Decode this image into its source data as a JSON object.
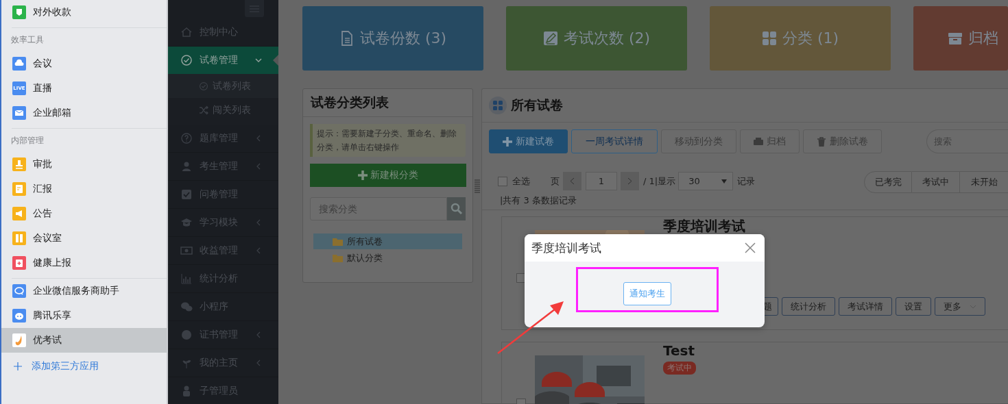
{
  "sidebar": {
    "groups": [
      {
        "items": [
          {
            "label": "对外收款",
            "color": "#2bb34a",
            "selected": false
          }
        ]
      },
      {
        "heading": "效率工具",
        "items": [
          {
            "label": "会议",
            "color": "#4a8cf0",
            "selected": false
          },
          {
            "label": "直播",
            "color": "#4a8cf0",
            "badge": "LIVE",
            "selected": false
          },
          {
            "label": "企业邮箱",
            "color": "#4a8cf0",
            "selected": false
          }
        ]
      },
      {
        "heading": "内部管理",
        "items": [
          {
            "label": "审批",
            "color": "#f7b21b",
            "selected": false
          },
          {
            "label": "汇报",
            "color": "#f7b21b",
            "selected": false
          },
          {
            "label": "公告",
            "color": "#f7b21b",
            "selected": false
          },
          {
            "label": "会议室",
            "color": "#f7b21b",
            "selected": false
          },
          {
            "label": "健康上报",
            "color": "#f0505f",
            "selected": false
          }
        ]
      },
      {
        "items": [
          {
            "label": "企业微信服务商助手",
            "color": "#4a8cf0",
            "selected": false
          },
          {
            "label": "腾讯乐享",
            "color": "#4a8cf0",
            "selected": false
          },
          {
            "label": "优考试",
            "color": "#ffffff",
            "selected": true
          }
        ]
      }
    ],
    "add_link": "添加第三方应用"
  },
  "nav": {
    "items": [
      {
        "label": "控制中心",
        "selected": false
      },
      {
        "label": "试卷管理",
        "expanded": true,
        "selected": true,
        "children": [
          {
            "label": "试卷列表",
            "selected": true
          },
          {
            "label": "闯关列表",
            "selected": false
          }
        ]
      },
      {
        "label": "题库管理",
        "expanded": false,
        "selected": false
      },
      {
        "label": "考生管理",
        "expanded": false,
        "selected": false
      },
      {
        "label": "问卷管理",
        "selected": false
      },
      {
        "label": "学习模块",
        "expanded": false,
        "selected": false
      },
      {
        "label": "收益管理",
        "expanded": false,
        "selected": false
      },
      {
        "label": "统计分析",
        "selected": false
      },
      {
        "label": "小程序",
        "selected": false
      },
      {
        "label": "证书管理",
        "expanded": false,
        "selected": false
      },
      {
        "label": "我的主页",
        "expanded": false,
        "selected": false
      },
      {
        "label": "子管理员",
        "selected": false
      }
    ]
  },
  "stats": [
    {
      "label": "试卷份数 (3)",
      "color": "#264a62"
    },
    {
      "label": "考试次数 (2)",
      "color": "#3d5633"
    },
    {
      "label": "分类 (1)",
      "color": "#63573a"
    },
    {
      "label": "归档",
      "color": "#623b31"
    }
  ],
  "category_panel": {
    "title": "试卷分类列表",
    "hint": "提示：需要新建子分类、重命名、删除分类，请单击右键操作",
    "new_button": "新建根分类",
    "search": {
      "placeholder": "搜索分类"
    },
    "tree": [
      {
        "label": "所有试卷",
        "selected": true
      },
      {
        "label": "默认分类",
        "selected": false
      }
    ]
  },
  "main_panel": {
    "title": "所有试卷",
    "toolbar": [
      {
        "label": "新建试卷",
        "kind": "primary"
      },
      {
        "label": "一周考试详情",
        "kind": "outline"
      },
      {
        "label": "移动到分类",
        "kind": "plain"
      },
      {
        "label": "归档",
        "kind": "archive"
      },
      {
        "label": "删除试卷",
        "kind": "delete"
      }
    ],
    "search": {
      "placeholder": "搜索"
    },
    "pager": {
      "select_all": {
        "label": "全选",
        "checked": false
      },
      "page_label": "页",
      "page": "1",
      "total": "/ 1|显示",
      "page_size": "30",
      "records": "记录"
    },
    "filters": [
      {
        "label": "已考完",
        "selected": false
      },
      {
        "label": "考试中",
        "selected": false
      },
      {
        "label": "未开始",
        "selected": false
      }
    ],
    "summary": "|共有 3 条数据记录",
    "exams": [
      {
        "title": "季度培训考试",
        "checked": false,
        "actions": [
          {
            "label": "题",
            "kind": "plain"
          },
          {
            "label": "统计分析",
            "kind": "plain"
          },
          {
            "label": "考试详情",
            "kind": "plain"
          },
          {
            "label": "设置",
            "kind": "plain"
          },
          {
            "label": "更多",
            "kind": "dropdown"
          }
        ]
      },
      {
        "title": "Test",
        "checked": false,
        "status": "考试中"
      }
    ]
  },
  "modal": {
    "title": "季度培训考试",
    "button": "通知考生"
  }
}
